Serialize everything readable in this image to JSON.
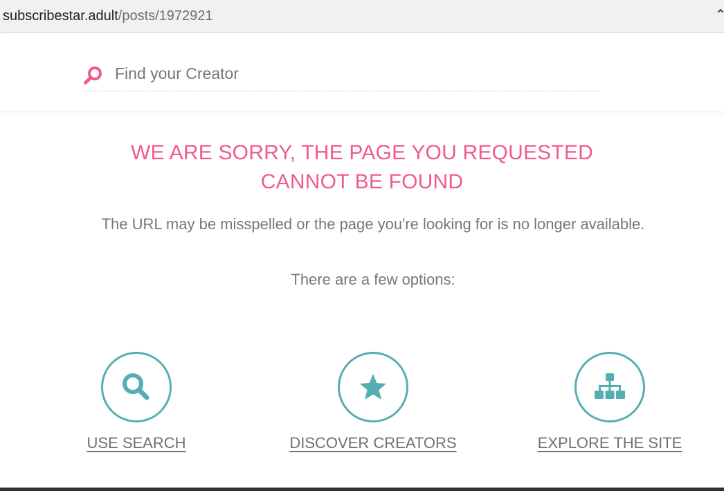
{
  "browser": {
    "url_domain": "subscribestar.adult",
    "url_path": "/posts/1972921"
  },
  "search": {
    "placeholder": "Find your Creator",
    "icon": "search-icon"
  },
  "error": {
    "title_line1": "WE ARE SORRY, THE PAGE YOU REQUESTED",
    "title_line2": "CANNOT BE FOUND",
    "description": "The URL may be misspelled or the page you're looking for is no longer available.",
    "options_intro": "There are a few options:"
  },
  "options": [
    {
      "label": "USE SEARCH",
      "icon": "search-icon"
    },
    {
      "label": "DISCOVER CREATORS",
      "icon": "star-icon"
    },
    {
      "label": "EXPLORE THE SITE",
      "icon": "sitemap-icon"
    }
  ],
  "colors": {
    "accent_pink": "#f15a8a",
    "accent_teal": "#55aeb1",
    "text_gray": "#777777"
  }
}
